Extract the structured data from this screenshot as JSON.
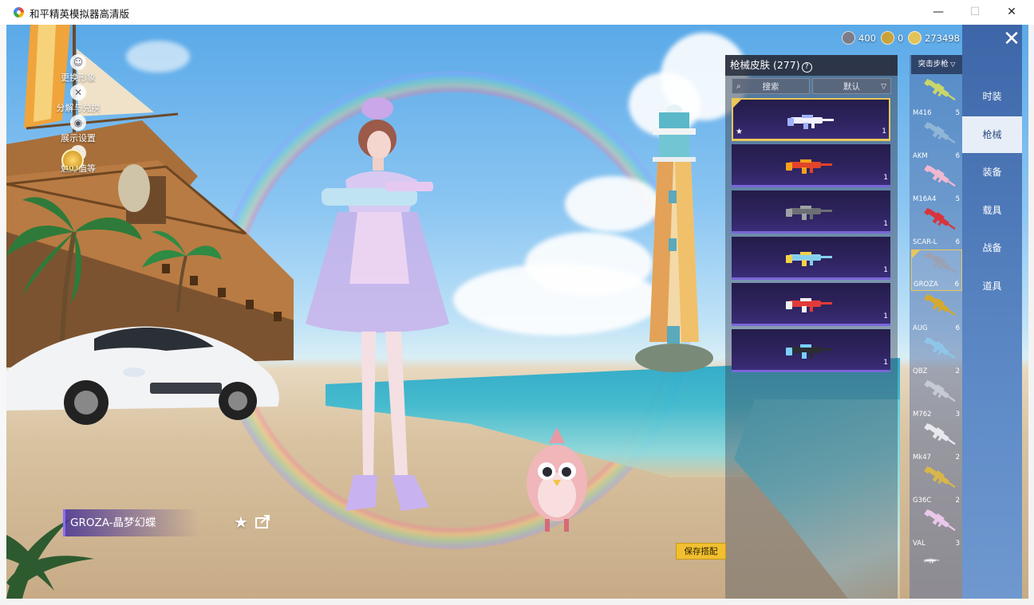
{
  "window": {
    "title": "和平精英模拟器高清版",
    "minimize_glyph": "—",
    "maximize_glyph": "☐",
    "close_glyph": "✕"
  },
  "left_menu": [
    {
      "label": "更换形象",
      "icon": "person-icon"
    },
    {
      "label": "分解与兑换",
      "icon": "decompose-icon"
    },
    {
      "label": "展示设置",
      "icon": "eye-icon"
    },
    {
      "label": "魅力值等",
      "icon": "charm-icon"
    }
  ],
  "rank": {
    "value": "403"
  },
  "currency": [
    {
      "name": "points",
      "value": "400",
      "color": "#7c7c8a"
    },
    {
      "name": "token",
      "value": "0",
      "color": "#c9a23a"
    },
    {
      "name": "coupon",
      "value": "273498",
      "color": "#e2c357"
    }
  ],
  "skin_panel": {
    "title": "枪械皮肤 (277)",
    "help_glyph": "?",
    "search_placeholder": "搜索",
    "sort_label": "默认",
    "skins": [
      {
        "count": "1",
        "selected": true,
        "starred": true,
        "gun_color": "#f0f0ff",
        "accent": "#9fb2ff"
      },
      {
        "count": "1",
        "selected": false,
        "starred": false,
        "gun_color": "#e0442a",
        "accent": "#f4a21c"
      },
      {
        "count": "1",
        "selected": false,
        "starred": false,
        "gun_color": "#6c6f73",
        "accent": "#9ea2a6"
      },
      {
        "count": "1",
        "selected": false,
        "starred": false,
        "gun_color": "#86d0ee",
        "accent": "#f2d24a"
      },
      {
        "count": "1",
        "selected": false,
        "starred": false,
        "gun_color": "#e23a3a",
        "accent": "#f0f0f0"
      },
      {
        "count": "1",
        "selected": false,
        "starred": false,
        "gun_color": "#2b2d33",
        "accent": "#7ad0ff"
      }
    ]
  },
  "weapon_list": {
    "category": "突击步枪",
    "items": [
      {
        "name": "M416",
        "count": "5",
        "color": "#c9d66a"
      },
      {
        "name": "AKM",
        "count": "6",
        "color": "#8fb6d6"
      },
      {
        "name": "M16A4",
        "count": "5",
        "color": "#f0b8cf"
      },
      {
        "name": "SCAR-L",
        "count": "6",
        "color": "#d8343c"
      },
      {
        "name": "GROZA",
        "count": "6",
        "color": "#9aa2b4",
        "selected": true
      },
      {
        "name": "AUG",
        "count": "6",
        "color": "#d6a92e"
      },
      {
        "name": "QBZ",
        "count": "2",
        "color": "#8ec6ea"
      },
      {
        "name": "M762",
        "count": "3",
        "color": "#c6cad2"
      },
      {
        "name": "Mk47",
        "count": "2",
        "color": "#e8e8ee"
      },
      {
        "name": "G36C",
        "count": "2",
        "color": "#d9b64a"
      },
      {
        "name": "VAL",
        "count": "3",
        "color": "#eac8ea"
      }
    ]
  },
  "tabs": [
    {
      "label": "时装",
      "active": false
    },
    {
      "label": "枪械",
      "active": true
    },
    {
      "label": "装备",
      "active": false
    },
    {
      "label": "载具",
      "active": false
    },
    {
      "label": "战备",
      "active": false
    },
    {
      "label": "道具",
      "active": false
    }
  ],
  "showcase": {
    "skin_name": "GROZA-晶梦幻蝶",
    "favorite_glyph": "★",
    "save_label": "保存搭配"
  },
  "colors": {
    "accent_gold": "#e9c75a",
    "panel_purple": "#2f2460",
    "tab_blue": "#3d66a8"
  }
}
